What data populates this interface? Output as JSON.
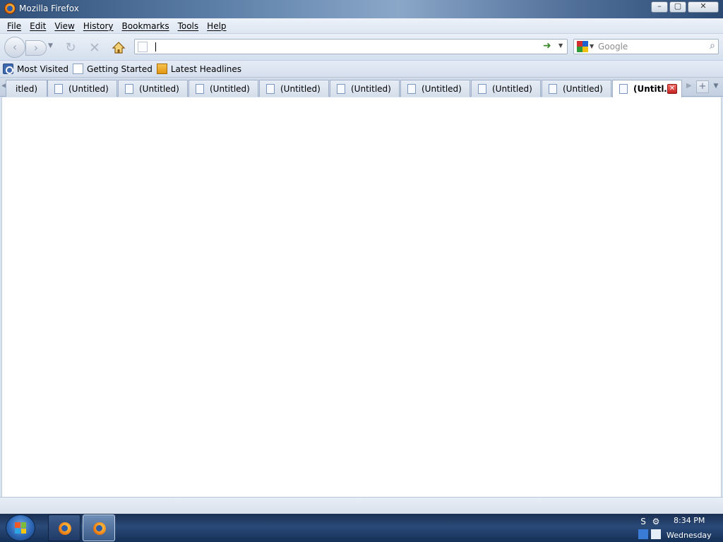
{
  "window": {
    "title": "Mozilla Firefox"
  },
  "menu": [
    {
      "key": "F",
      "rest": "ile"
    },
    {
      "key": "E",
      "rest": "dit"
    },
    {
      "key": "V",
      "rest": "iew"
    },
    {
      "key": "H",
      "rest": "istory"
    },
    {
      "key": "B",
      "rest": "ookmarks"
    },
    {
      "key": "T",
      "rest": "ools"
    },
    {
      "key": "H",
      "rest": "elp"
    }
  ],
  "urlbar": {
    "value": "",
    "placeholder": ""
  },
  "search": {
    "placeholder": "Google"
  },
  "bookmarks": [
    {
      "label": "Most Visited",
      "icon": "folder-icon"
    },
    {
      "label": "Getting Started",
      "icon": "page-icon"
    },
    {
      "label": "Latest Headlines",
      "icon": "rss-icon"
    }
  ],
  "tabs": [
    {
      "label": "itled)"
    },
    {
      "label": "(Untitled)"
    },
    {
      "label": "(Untitled)"
    },
    {
      "label": "(Untitled)"
    },
    {
      "label": "(Untitled)"
    },
    {
      "label": "(Untitled)"
    },
    {
      "label": "(Untitled)"
    },
    {
      "label": "(Untitled)"
    },
    {
      "label": "(Untitled)"
    },
    {
      "label": "(Untitl…",
      "active": true
    }
  ],
  "taskbar": {
    "time": "8:34 PM",
    "day": "Wednesday"
  }
}
